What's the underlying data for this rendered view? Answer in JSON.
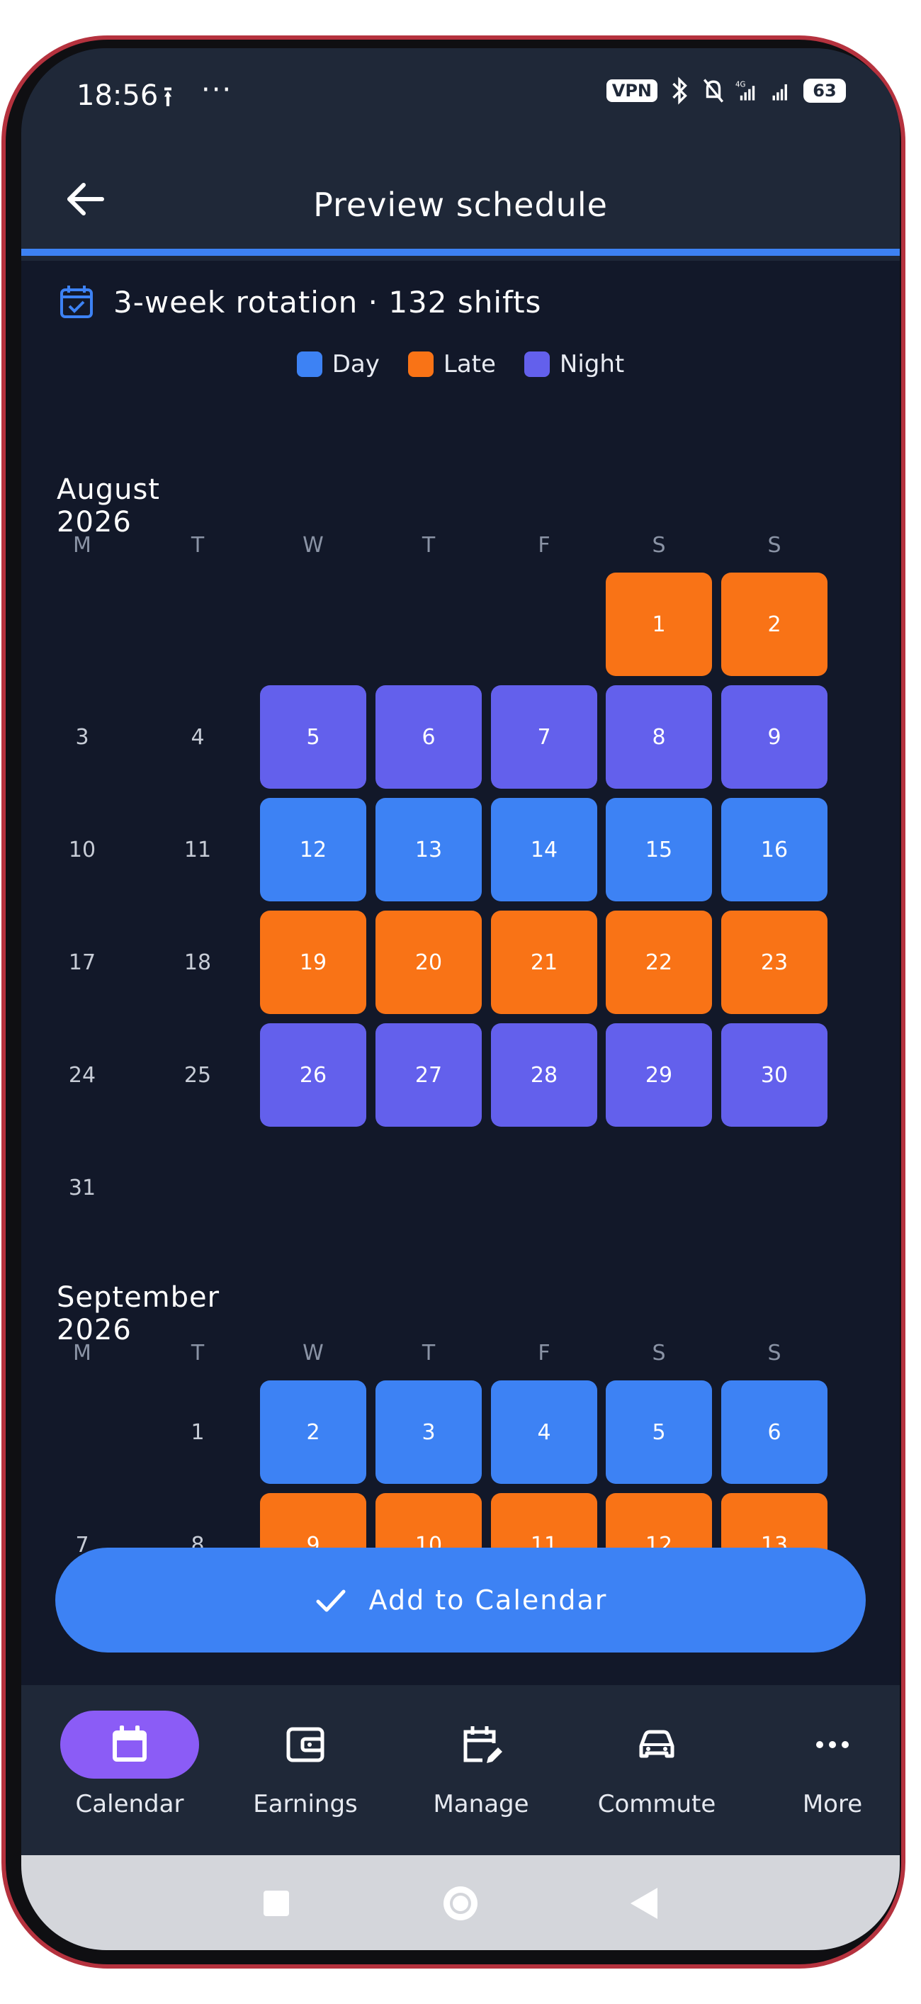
{
  "status_bar": {
    "time": "18:56",
    "upload_glyph": "⭱",
    "more_glyph": "···",
    "vpn": "VPN",
    "network": "4G",
    "battery": "63"
  },
  "app_bar": {
    "title": "Preview schedule"
  },
  "summary": {
    "text": "3-week rotation · 132 shifts"
  },
  "legend": [
    {
      "label": "Day",
      "color": "#3d82f4"
    },
    {
      "label": "Late",
      "color": "#f97316"
    },
    {
      "label": "Night",
      "color": "#6360ec"
    }
  ],
  "colors": {
    "day": "#3d82f4",
    "late": "#f97316",
    "night": "#6360ec",
    "accent": "#3d82f4",
    "nav_active": "#8b5cf6"
  },
  "weekdays": [
    "M",
    "T",
    "W",
    "T",
    "F",
    "S",
    "S"
  ],
  "months": [
    {
      "title": "August 2026",
      "first_weekday": 5,
      "days": [
        {
          "d": "1",
          "shift": "late"
        },
        {
          "d": "2",
          "shift": "late"
        },
        {
          "d": "3",
          "shift": ""
        },
        {
          "d": "4",
          "shift": ""
        },
        {
          "d": "5",
          "shift": "night"
        },
        {
          "d": "6",
          "shift": "night"
        },
        {
          "d": "7",
          "shift": "night"
        },
        {
          "d": "8",
          "shift": "night"
        },
        {
          "d": "9",
          "shift": "night"
        },
        {
          "d": "10",
          "shift": ""
        },
        {
          "d": "11",
          "shift": ""
        },
        {
          "d": "12",
          "shift": "day"
        },
        {
          "d": "13",
          "shift": "day"
        },
        {
          "d": "14",
          "shift": "day"
        },
        {
          "d": "15",
          "shift": "day"
        },
        {
          "d": "16",
          "shift": "day"
        },
        {
          "d": "17",
          "shift": ""
        },
        {
          "d": "18",
          "shift": ""
        },
        {
          "d": "19",
          "shift": "late"
        },
        {
          "d": "20",
          "shift": "late"
        },
        {
          "d": "21",
          "shift": "late"
        },
        {
          "d": "22",
          "shift": "late"
        },
        {
          "d": "23",
          "shift": "late"
        },
        {
          "d": "24",
          "shift": ""
        },
        {
          "d": "25",
          "shift": ""
        },
        {
          "d": "26",
          "shift": "night"
        },
        {
          "d": "27",
          "shift": "night"
        },
        {
          "d": "28",
          "shift": "night"
        },
        {
          "d": "29",
          "shift": "night"
        },
        {
          "d": "30",
          "shift": "night"
        },
        {
          "d": "31",
          "shift": ""
        }
      ]
    },
    {
      "title": "September 2026",
      "first_weekday": 1,
      "days": [
        {
          "d": "1",
          "shift": ""
        },
        {
          "d": "2",
          "shift": "day"
        },
        {
          "d": "3",
          "shift": "day"
        },
        {
          "d": "4",
          "shift": "day"
        },
        {
          "d": "5",
          "shift": "day"
        },
        {
          "d": "6",
          "shift": "day"
        },
        {
          "d": "7",
          "shift": ""
        },
        {
          "d": "8",
          "shift": ""
        },
        {
          "d": "9",
          "shift": "late"
        },
        {
          "d": "10",
          "shift": "late"
        },
        {
          "d": "11",
          "shift": "late"
        },
        {
          "d": "12",
          "shift": "late"
        },
        {
          "d": "13",
          "shift": "late"
        }
      ]
    }
  ],
  "action": {
    "label": "Add to Calendar"
  },
  "bottom_nav": [
    {
      "label": "Calendar",
      "icon": "calendar-icon",
      "active": true
    },
    {
      "label": "Earnings",
      "icon": "wallet-icon",
      "active": false
    },
    {
      "label": "Manage",
      "icon": "calendar-edit-icon",
      "active": false
    },
    {
      "label": "Commute",
      "icon": "car-icon",
      "active": false
    },
    {
      "label": "More",
      "icon": "more-icon",
      "active": false
    }
  ]
}
